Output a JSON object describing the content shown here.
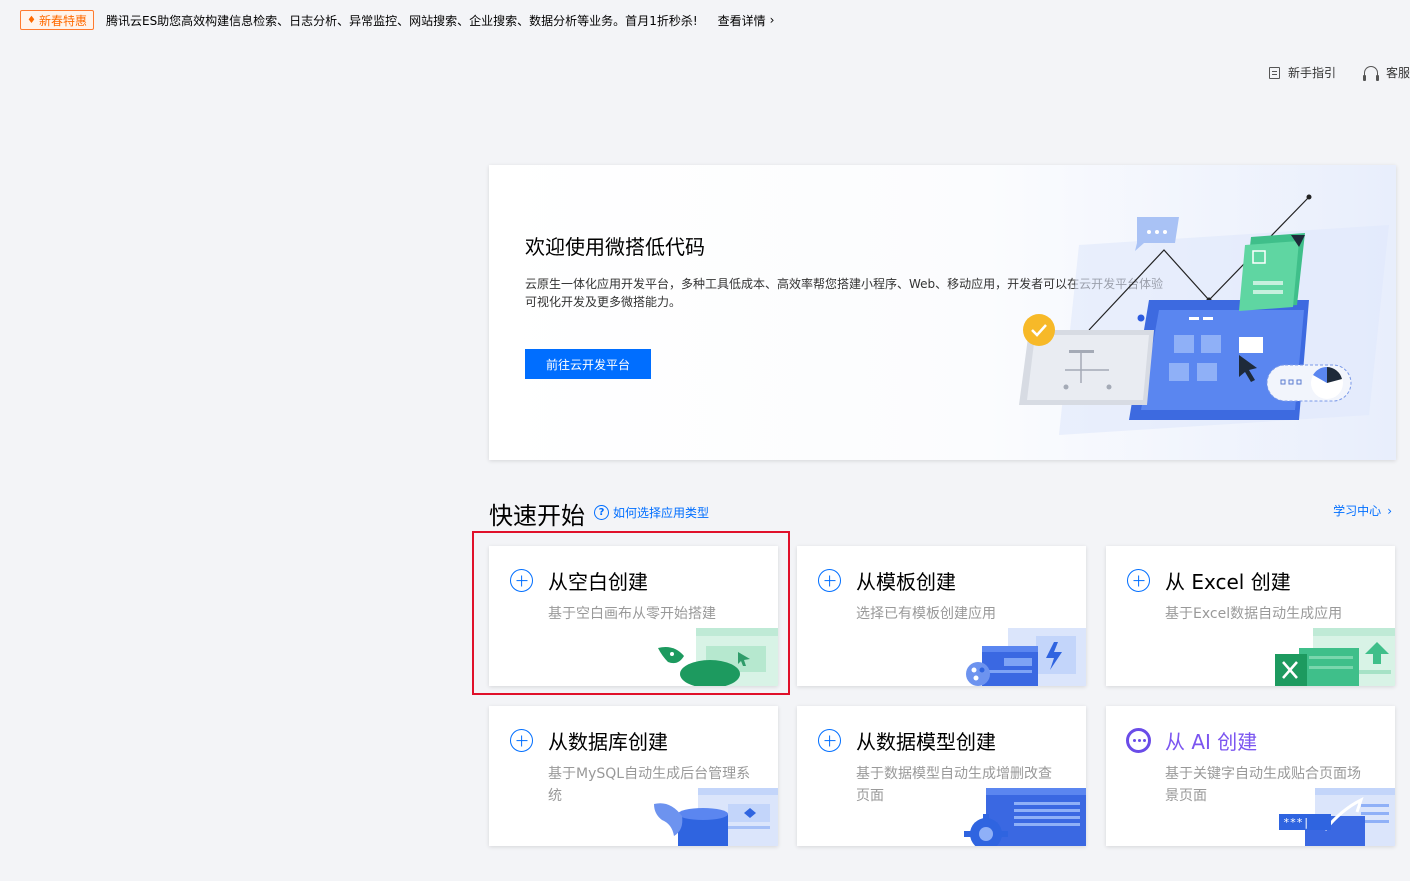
{
  "promo": {
    "tag": "新春特惠",
    "text": "腾讯云ES助您高效构建信息检索、日志分析、异常监控、网站搜索、企业搜索、数据分析等业务。首月1折秒杀!",
    "link": "查看详情"
  },
  "top_links": {
    "guide": "新手指引",
    "service": "客服"
  },
  "welcome": {
    "title": "欢迎使用微搭低代码",
    "desc_line1": "云原生一体化应用开发平台，多种工具低成本、高效率帮您搭建小程序、Web、移动应用，开发者可以在云开发平台体验",
    "desc_line2": "可视化开发及更多微搭能力。",
    "button": "前往云开发平台"
  },
  "quick_start": {
    "title": "快速开始",
    "help": "如何选择应用类型",
    "learn": "学习中心"
  },
  "cards": [
    {
      "title": "从空白创建",
      "desc": "基于空白画布从零开始搭建"
    },
    {
      "title": "从模板创建",
      "desc": "选择已有模板创建应用"
    },
    {
      "title": "从 Excel 创建",
      "desc": "基于Excel数据自动生成应用"
    },
    {
      "title": "从数据库创建",
      "desc": "基于MySQL自动生成后台管理系统"
    },
    {
      "title": "从数据模型创建",
      "desc": "基于数据模型自动生成增删改查页面"
    },
    {
      "title": "从 AI 创建",
      "desc": "基于关键字自动生成贴合页面场景页面"
    }
  ],
  "colors": {
    "primary": "#006eff",
    "highlight": "#e0102a",
    "ai": "#7b55f0",
    "promo": "#ff6a00"
  }
}
